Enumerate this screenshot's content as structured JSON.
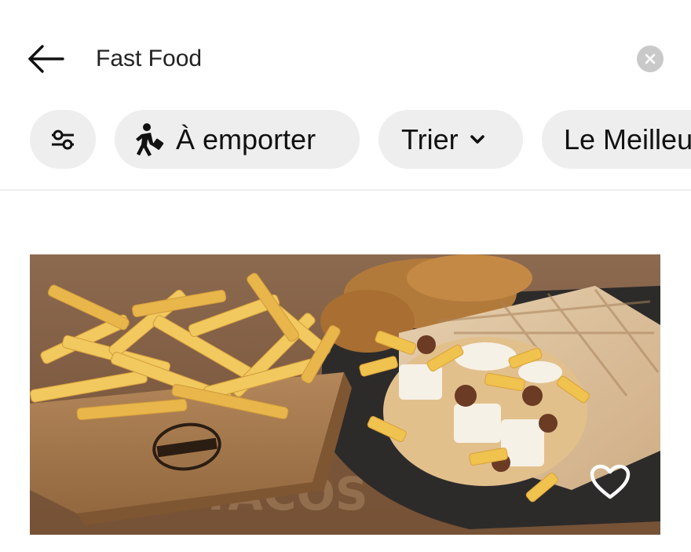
{
  "search": {
    "value": "Fast Food",
    "back_icon": "arrow-left-icon",
    "clear_icon": "clear-x-icon"
  },
  "filters": {
    "filter_icon": "sliders-icon",
    "chips": [
      {
        "label": "À emporter",
        "icon": "walking-person-icon"
      },
      {
        "label": "Trier",
        "icon": "chevron-down-icon"
      },
      {
        "label": "Le Meilleu"
      }
    ]
  },
  "restaurant": {
    "image_alt": "fries and tacos",
    "brand_print": "O'TACOS",
    "favorite_icon": "heart-outline-icon"
  },
  "colors": {
    "chip_bg": "#eeeeee",
    "clear_bg": "#c9c9c9",
    "divider": "#eeeeee"
  }
}
